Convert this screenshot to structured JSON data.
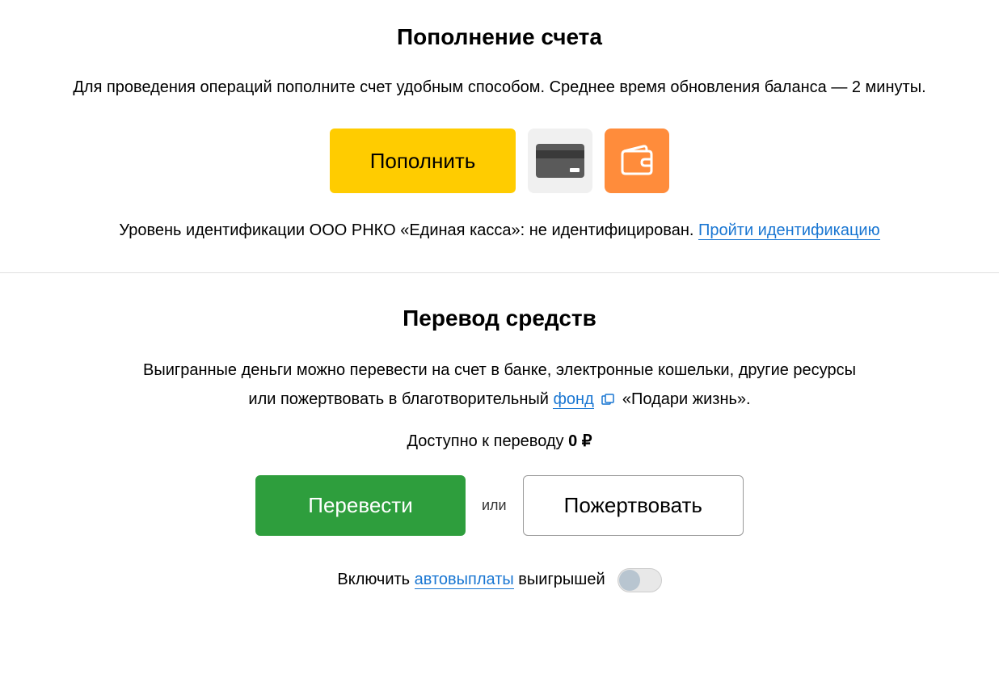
{
  "deposit": {
    "title": "Пополнение счета",
    "description": "Для проведения операций пополните счет удобным способом. Среднее время обновления баланса — 2 минуты.",
    "button_label": "Пополнить",
    "identification_prefix": "Уровень идентификации ООО РНКО «Единая касса»: не идентифицирован. ",
    "identification_link": "Пройти идентификацию"
  },
  "transfer": {
    "title": "Перевод средств",
    "desc_line1": "Выигранные деньги можно перевести на счет в банке, электронные кошельки, другие ресурсы",
    "desc_line2_prefix": "или пожертвовать в благотворительный ",
    "desc_line2_link": "фонд",
    "desc_line2_suffix": "«Подари жизнь».",
    "available_prefix": "Доступно к переводу ",
    "available_amount": "0 ₽",
    "button_transfer": "Перевести",
    "or_label": "или",
    "button_donate": "Пожертвовать",
    "autopay_prefix": "Включить ",
    "autopay_link": "автовыплаты",
    "autopay_suffix": " выигрышей"
  }
}
